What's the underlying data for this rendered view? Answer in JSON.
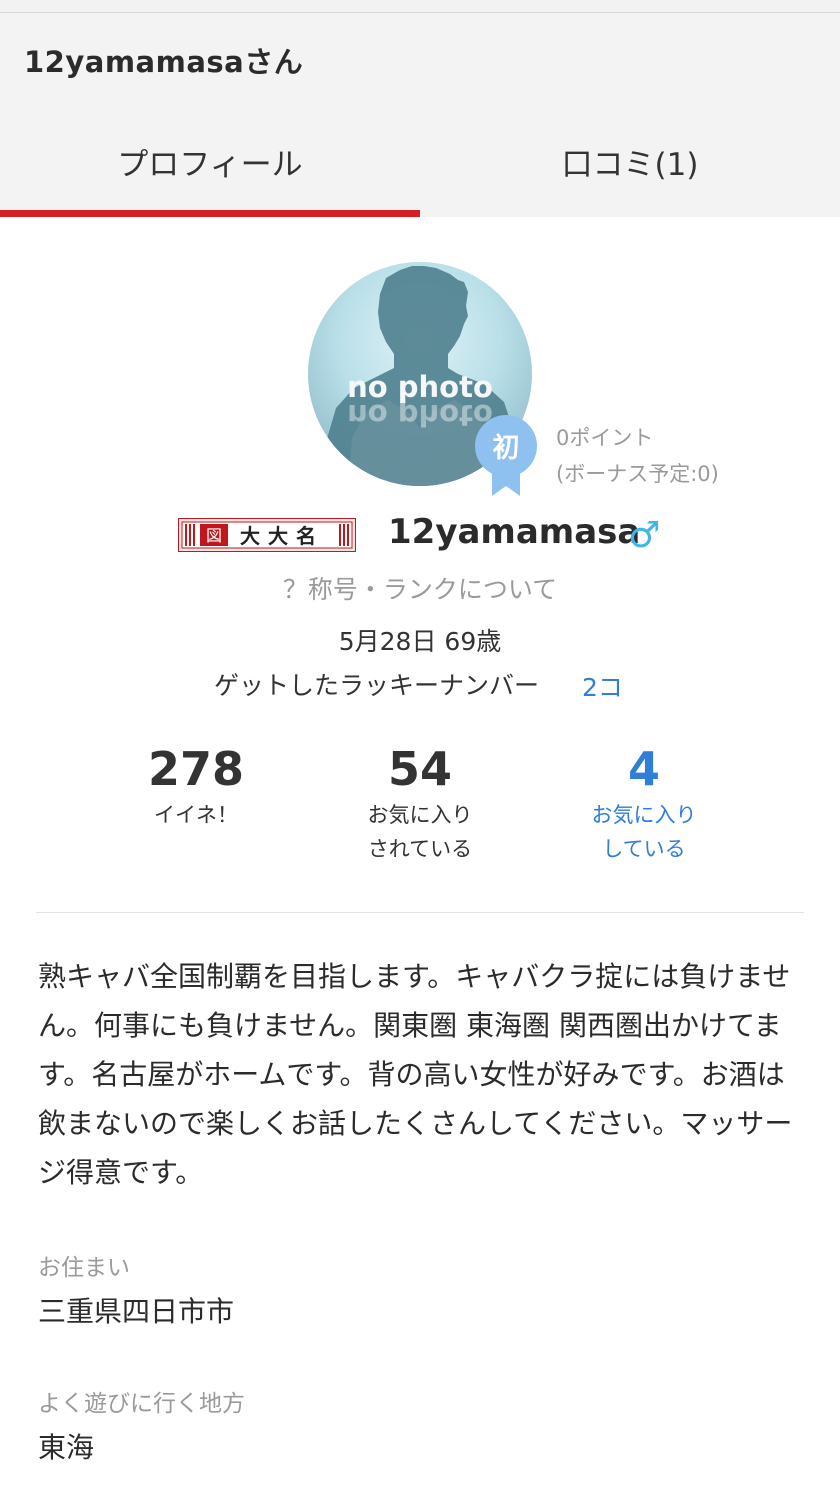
{
  "header": {
    "title": "12yamamasaさん"
  },
  "tabs": [
    {
      "label": "プロフィール",
      "active": true
    },
    {
      "label": "口コミ(1)",
      "active": false
    }
  ],
  "accent_color": "#d51f23",
  "link_color": "#2f7ed8",
  "profile": {
    "avatar_text": "no photo",
    "badge_text": "初",
    "points": "0ポイント",
    "bonus": "(ボーナス予定:0)",
    "rank_badge_text": "大大名",
    "rank_badge_mark": "図",
    "username": "12yamamasa",
    "gender_icon": "♂",
    "rank_link": "？称号・ランクについて",
    "birthday_age": "5月28日 69歳",
    "lucky_label": "ゲットしたラッキーナンバー",
    "lucky_value": "2コ"
  },
  "stats": [
    {
      "value": "278",
      "label1": "イイネ！",
      "label2": ""
    },
    {
      "value": "54",
      "label1": "お気に入り",
      "label2": "されている"
    },
    {
      "value": "4",
      "label1": "お気に入り",
      "label2": "している"
    }
  ],
  "bio": "熟キャバ全国制覇を目指します。キャバクラ掟には負けません。何事にも負けません。関東圏 東海圏 関西圏出かけてます。名古屋がホームです。背の高い女性が好みです。お酒は飲まないので楽しくお話したくさんしてください。マッサージ得意です。",
  "fields": {
    "residence_label": "お住まい",
    "residence_value": "三重県四日市市",
    "area_label": "よく遊びに行く地方",
    "area_value": "東海"
  }
}
